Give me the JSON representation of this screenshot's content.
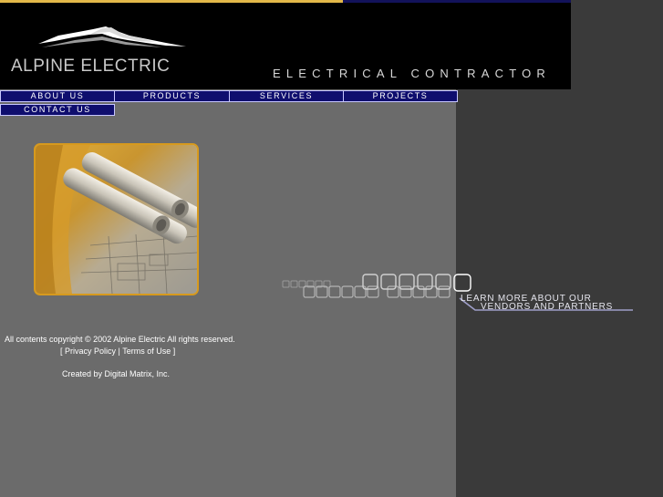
{
  "header": {
    "logo_text": "ALPINE ELECTRIC",
    "tagline": "ELECTRICAL CONTRACTOR",
    "logo_icon": "mountain-peaks-icon"
  },
  "nav": {
    "about": "ABOUT US",
    "products": "PRODUCTS",
    "services": "SERVICES",
    "projects": "PROJECTS",
    "contact": "CONTACT US"
  },
  "main": {
    "photo_icon": "blueprint-rolls-photo",
    "vendors": {
      "line1": "LEARN MORE ABOUT OUR",
      "line2": "VENDORS AND PARTNERS"
    }
  },
  "footer": {
    "copyright": "All contents copyright © 2002 Alpine Electric   All rights reserved.",
    "privacy_prefix": "[ ",
    "privacy": "Privacy Policy",
    "separator": " | ",
    "terms": "Terms of Use",
    "terms_suffix": " ]",
    "credit": "Created by Digital Matrix, Inc."
  },
  "colors": {
    "header_bg": "#000000",
    "left_panel": "#6b6b6b",
    "right_panel": "#3a3a3a",
    "nav_bg": "#0f0e6e",
    "accent_gold": "#e3b84a",
    "accent_navy": "#12125a",
    "photo_border": "#d79a1e"
  }
}
